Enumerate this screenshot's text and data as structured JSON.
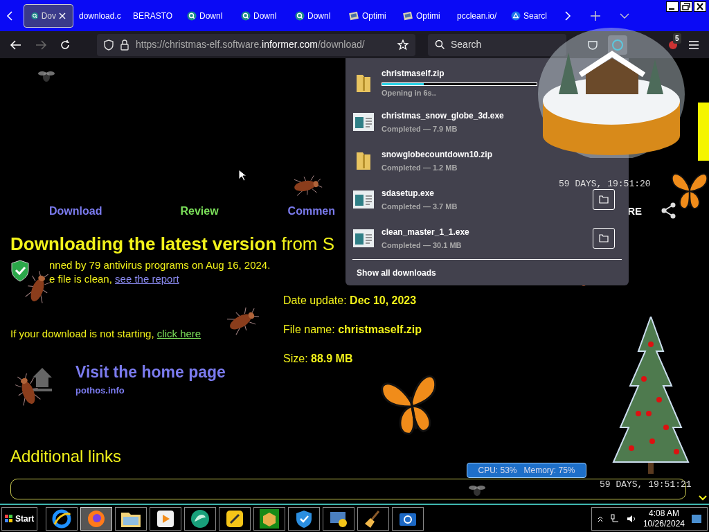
{
  "tabs": [
    {
      "label": "Dov",
      "selected": true
    },
    {
      "label": "download.c",
      "selected": false
    },
    {
      "label": "BERASTO",
      "selected": false
    },
    {
      "label": "Downl",
      "selected": false
    },
    {
      "label": "Downl",
      "selected": false
    },
    {
      "label": "Downl",
      "selected": false
    },
    {
      "label": "Optimi",
      "selected": false
    },
    {
      "label": "Optimi",
      "selected": false
    },
    {
      "label": "pcclean.io/",
      "selected": false
    },
    {
      "label": "Searcl",
      "selected": false
    }
  ],
  "address_bar": {
    "url_parts": [
      {
        "text": "https://christmas-elf.software.",
        "emphasis": false
      },
      {
        "text": "informer.com",
        "emphasis": true
      },
      {
        "text": "/download/",
        "emphasis": false
      }
    ]
  },
  "search_bar": {
    "placeholder": "Search"
  },
  "extension_badge": "5",
  "page": {
    "nav_links": [
      {
        "label": "Download",
        "color": "#7b7bef"
      },
      {
        "label": "Review",
        "color": "#7be05a"
      },
      {
        "label": "Commen",
        "color": "#7b7bef"
      }
    ],
    "share_label": "RE",
    "heading": "**Downloading the latest version** from S",
    "scan_text": "nned by 79 antivirus programs on Aug 16, 2024.",
    "clean_text": "e file is clean,",
    "report_link": "see the report",
    "not_starting_text": "If your download is not starting,",
    "click_here_link": "click here",
    "home_title": "Visit the home page",
    "home_site": "pothos.info",
    "details": [
      "Date update: **Dec 10, 2023**",
      "File name: **christmaself.zip**",
      "Size: **88.9 MB**"
    ],
    "additional_links": "Additional links"
  },
  "downloads_panel": {
    "items": [
      {
        "name": "christmaself.zip",
        "status": "Opening in 6s..",
        "kind": "zip",
        "level": 0.27,
        "folder_button": false
      },
      {
        "name": "christmas_snow_globe_3d.exe",
        "status": "Completed — 7.9 MB",
        "kind": "exe",
        "folder_button": false
      },
      {
        "name": "snowglobecountdown10.zip",
        "status": "Completed — 1.2 MB",
        "kind": "zip",
        "folder_button": false
      },
      {
        "name": "sdasetup.exe",
        "status": "Completed — 3.7 MB",
        "kind": "exe",
        "folder_button": true
      },
      {
        "name": "clean_master_1_1.exe",
        "status": "Completed — 30.1 MB",
        "kind": "exe",
        "folder_button": true
      }
    ],
    "show_all": "Show all downloads"
  },
  "desktop": {
    "countdowns": [
      "59 DAYS, 19:51:20",
      "59 DAYS, 19:51:21"
    ],
    "cpu_meter": "CPU: 53%   Memory: 75%"
  },
  "taskbar": {
    "start": "Start",
    "apps": [
      {
        "selected": false
      },
      {
        "selected": true
      },
      {
        "selected": false
      },
      {
        "selected": false
      },
      {
        "selected": false
      },
      {
        "selected": false
      },
      {
        "selected": false
      },
      {
        "selected": false
      },
      {
        "selected": false
      },
      {
        "selected": false
      },
      {
        "selected": false
      }
    ],
    "time": "4:08 AM",
    "date": "10/26/2024"
  }
}
